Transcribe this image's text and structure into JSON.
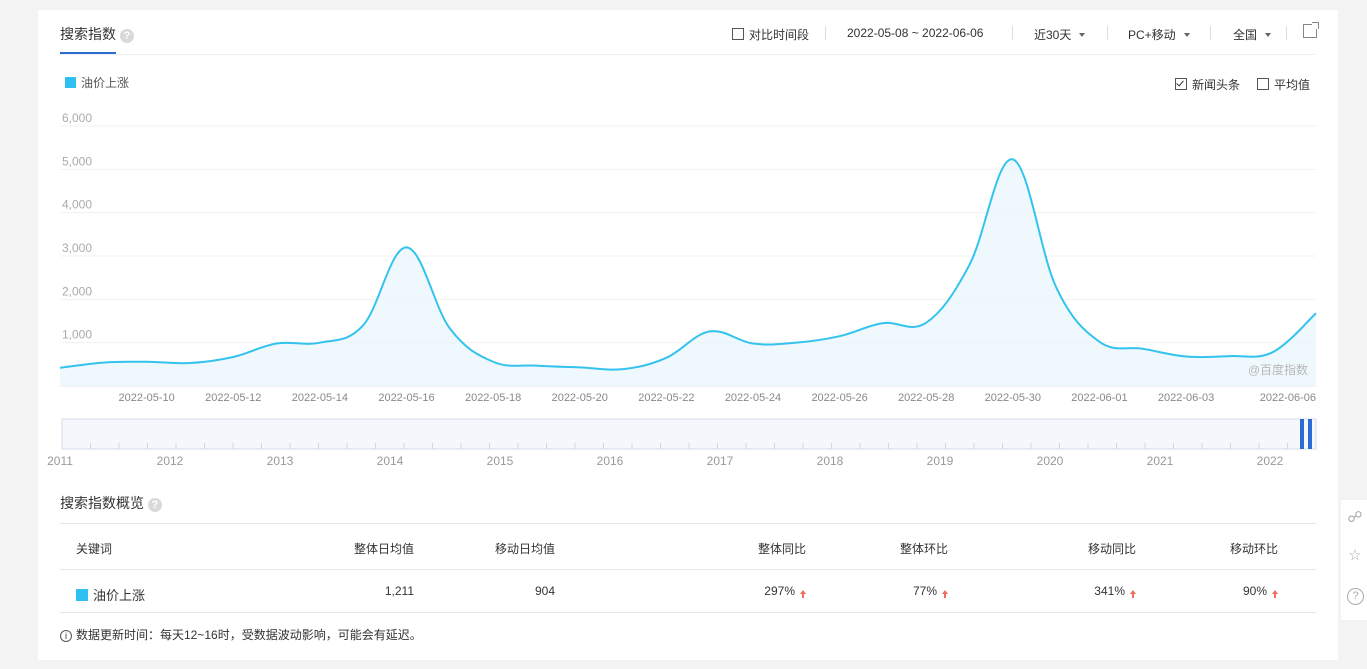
{
  "header": {
    "title": "搜索指数",
    "help": "?",
    "compare_label": "对比时间段",
    "date_range": "2022-05-08 ~ 2022-06-06",
    "period": "近30天",
    "device": "PC+移动",
    "region": "全国"
  },
  "legend": {
    "series_name": "油价上涨",
    "series_color": "#2ec0f0"
  },
  "options": {
    "news_label": "新闻头条",
    "news_checked": true,
    "avg_label": "平均值",
    "avg_checked": false
  },
  "watermark": "@百度指数",
  "chart_data": {
    "type": "area",
    "x": [
      "2022-05-08",
      "2022-05-09",
      "2022-05-10",
      "2022-05-11",
      "2022-05-12",
      "2022-05-13",
      "2022-05-14",
      "2022-05-15",
      "2022-05-16",
      "2022-05-17",
      "2022-05-18",
      "2022-05-19",
      "2022-05-20",
      "2022-05-21",
      "2022-05-22",
      "2022-05-23",
      "2022-05-24",
      "2022-05-25",
      "2022-05-26",
      "2022-05-27",
      "2022-05-28",
      "2022-05-29",
      "2022-05-30",
      "2022-05-31",
      "2022-06-01",
      "2022-06-02",
      "2022-06-03",
      "2022-06-04",
      "2022-06-05",
      "2022-06-06"
    ],
    "series": [
      {
        "name": "油价上涨",
        "values": [
          420,
          540,
          560,
          530,
          670,
          980,
          1000,
          1400,
          3200,
          1330,
          560,
          470,
          430,
          390,
          650,
          1260,
          980,
          1000,
          1150,
          1450,
          1460,
          2800,
          5230,
          2280,
          1020,
          860,
          680,
          690,
          780,
          1680
        ]
      }
    ],
    "ylim": [
      0,
      6000
    ],
    "yticks": [
      "6,000",
      "5,000",
      "4,000",
      "3,000",
      "2,000",
      "1,000"
    ],
    "xtick_labels": [
      "2022-05-10",
      "2022-05-12",
      "2022-05-14",
      "2022-05-16",
      "2022-05-18",
      "2022-05-20",
      "2022-05-22",
      "2022-05-24",
      "2022-05-26",
      "2022-05-28",
      "2022-05-30",
      "2022-06-01",
      "2022-06-03",
      "2022-06-06"
    ],
    "grid": true,
    "brush_years": [
      "2011",
      "2012",
      "2013",
      "2014",
      "2015",
      "2016",
      "2017",
      "2018",
      "2019",
      "2020",
      "2021",
      "2022"
    ]
  },
  "overview": {
    "title": "搜索指数概览",
    "columns": [
      "关键词",
      "整体日均值",
      "移动日均值",
      "整体同比",
      "整体环比",
      "移动同比",
      "移动环比"
    ],
    "row": {
      "keyword": "油价上涨",
      "overall_avg": "1,211",
      "mobile_avg": "904",
      "overall_yoy": "297%",
      "overall_mom": "77%",
      "mobile_yoy": "341%",
      "mobile_mom": "90%"
    }
  },
  "note": "数据更新时间：每天12~16时，受数据波动影响，可能会有延迟。",
  "side_icons": [
    "share-icon",
    "star-icon",
    "help-icon"
  ]
}
